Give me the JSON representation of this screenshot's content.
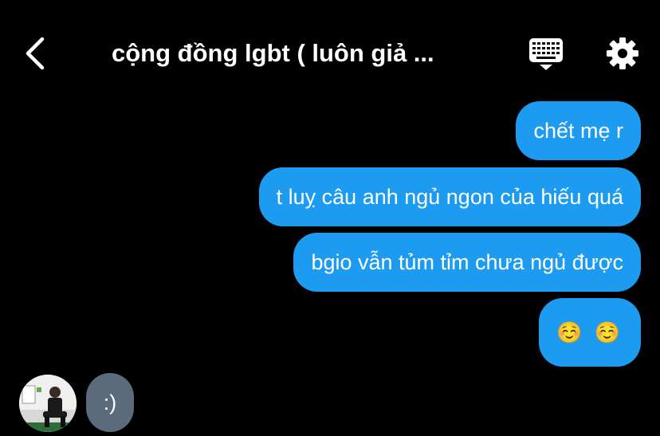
{
  "header": {
    "title": "cộng đồng lgbt ( luôn giả ...",
    "back_icon": "chevron-left-icon",
    "keyboard_icon": "keyboard-icon",
    "settings_icon": "gear-icon"
  },
  "messages": {
    "outgoing": [
      {
        "text": "chết mẹ r"
      },
      {
        "text": "t luỵ câu anh ngủ ngon của hiếu quá"
      },
      {
        "text": "bgio vẫn tủm tỉm chưa ngủ được"
      },
      {
        "text": "☺️ ☺️"
      }
    ],
    "incoming": [
      {
        "text": ":)"
      }
    ]
  },
  "colors": {
    "background": "#000000",
    "outgoing_bubble": "#1d9bf0",
    "incoming_bubble": "#5b6b7c",
    "text": "#ffffff"
  }
}
